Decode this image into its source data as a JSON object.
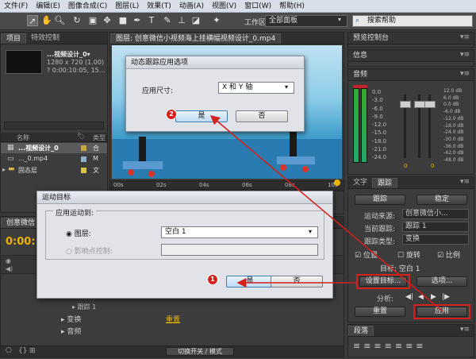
{
  "menubar": [
    "文件(F)",
    "编辑(E)",
    "图像合成(C)",
    "图层(L)",
    "效果(T)",
    "动画(A)",
    "视图(V)",
    "窗口(W)",
    "帮助(H)"
  ],
  "toolbar": {
    "workspace_label": "工作区:",
    "workspace_value": "全部面板",
    "search_placeholder": "搜索帮助"
  },
  "project": {
    "tabs": [
      "项目",
      "特效控制"
    ],
    "item_title": "...视频设计_0▾",
    "item_res": "1280 x 720 (1.00)",
    "item_dur": "? 0:00:10:05, 15...",
    "col_name": "名称",
    "col_type": "类型",
    "files": [
      {
        "name": "...视频设计_0",
        "type": "合"
      },
      {
        "name": "..._0.mp4",
        "type": "M"
      },
      {
        "name": "固态层",
        "type": "文"
      }
    ]
  },
  "viewer": {
    "title": "图层: 创意微信小视频海上挂横幅视频设计_0.mp4"
  },
  "ruler": [
    "00s",
    "02s",
    "04s",
    "06s",
    "08s",
    "10s"
  ],
  "timeline": {
    "tab": "创意微信",
    "time": "0:00:",
    "rows": [
      {
        "name": "跟踪 1"
      },
      {
        "name": "变换",
        "value": "重置"
      },
      {
        "name": "音频"
      }
    ],
    "footer": "切换开关 / 模式"
  },
  "right_panels": {
    "preview": "预览控制台",
    "info": "信息",
    "audio": "音频",
    "audio_left": [
      "0.0",
      "-3.0",
      "-6.0",
      "-9.0",
      "-12.0",
      "-15.0",
      "-18.0",
      "-21.0",
      "-24.0"
    ],
    "audio_right": [
      "12.0 dB",
      "6.0 dB",
      "0.0 dB",
      "-6.0 dB",
      "-12.0 dB",
      "-18.0 dB",
      "-24.0 dB",
      "-30.0 dB",
      "-36.0 dB",
      "-42.0 dB",
      "-48.0 dB"
    ],
    "audio_zero_left": "0",
    "audio_zero_right": "0"
  },
  "tracker": {
    "tabs": [
      "文字",
      "跟踪"
    ],
    "btn_track": "跟踪",
    "btn_stabilize": "稳定",
    "motion_source_label": "运动来源:",
    "motion_source_value": "创意微信小...",
    "current_track_label": "当前跟踪:",
    "current_track_value": "跟踪 1",
    "track_type_label": "跟踪类型:",
    "track_type_value": "变换",
    "cb_position": "位置",
    "cb_rotation": "旋转",
    "cb_scale": "比例",
    "target_label": "目标: 空白 1",
    "btn_set_target": "设置目标...",
    "btn_options": "选项...",
    "analyze_label": "分析:",
    "btn_reset": "重置",
    "btn_apply": "应用"
  },
  "paragraph": {
    "tab": "段落"
  },
  "dialog1": {
    "title": "动态跟踪应用选项",
    "dim_label": "应用尺寸:",
    "dim_value": "X 和 Y 轴",
    "btn_yes": "是",
    "btn_no": "否",
    "badge": "2"
  },
  "dialog2": {
    "title": "运动目标",
    "group": "应用运动到:",
    "opt_layer": "图层:",
    "layer_value": "空白 1",
    "opt_effect": "影响点控制:",
    "btn_yes": "是",
    "btn_no": "否",
    "badge": "1"
  },
  "colors": {
    "highlight_red": "#d6201c",
    "dialog_bg": "#e1e3e8",
    "timecode": "#e8b400"
  }
}
